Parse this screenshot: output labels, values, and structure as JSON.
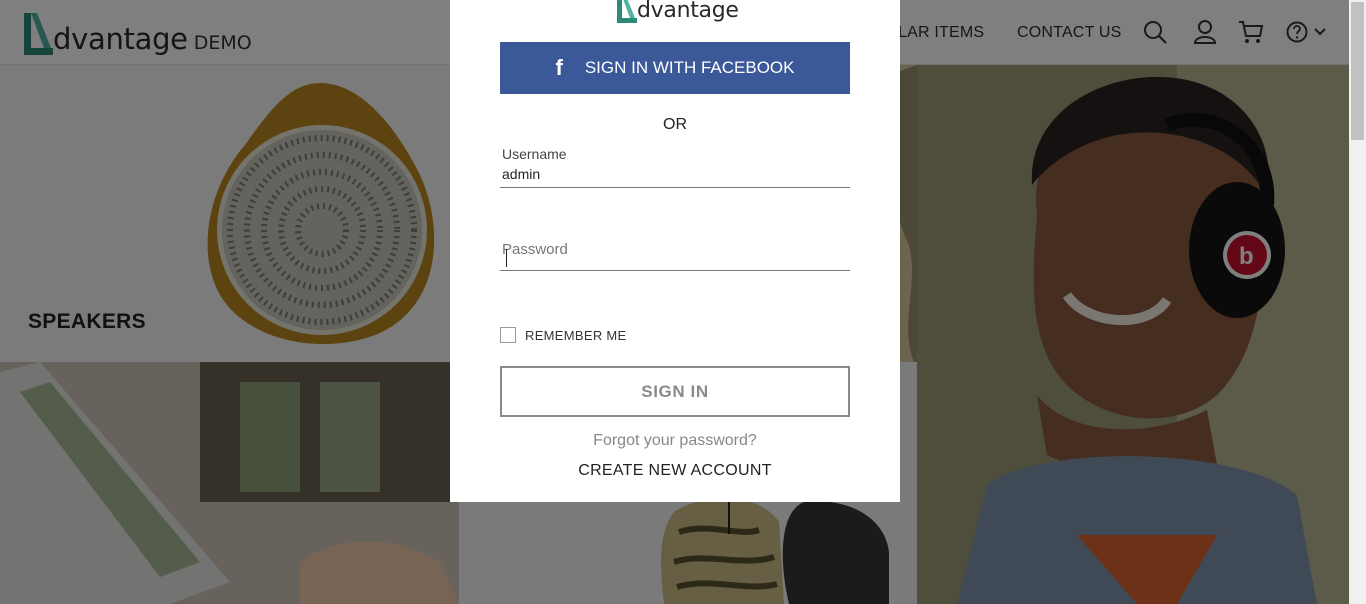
{
  "header": {
    "brand_word": "dvantage",
    "brand_suffix": "DEMO",
    "nav": {
      "popular_items": "LAR ITEMS",
      "contact_us": "CONTACT US"
    },
    "icons": [
      "search-icon",
      "user-icon",
      "cart-icon",
      "help-icon",
      "chevron-down-icon"
    ]
  },
  "tiles": {
    "speakers": {
      "title": "SPEAKERS"
    }
  },
  "login": {
    "logo_word": "dvantage",
    "facebook_label": "SIGN IN WITH FACEBOOK",
    "or_text": "OR",
    "username_label": "Username",
    "username_value": "admin",
    "password_placeholder": "Password",
    "remember_label": "REMEMBER ME",
    "remember_checked": false,
    "signin_label": "SIGN IN",
    "forgot_label": "Forgot your password?",
    "create_label": "CREATE NEW ACCOUNT"
  },
  "colors": {
    "brand_teal": "#2e8b78",
    "facebook_blue": "#3b5998",
    "overlay": "rgba(0,0,0,0.5)"
  }
}
